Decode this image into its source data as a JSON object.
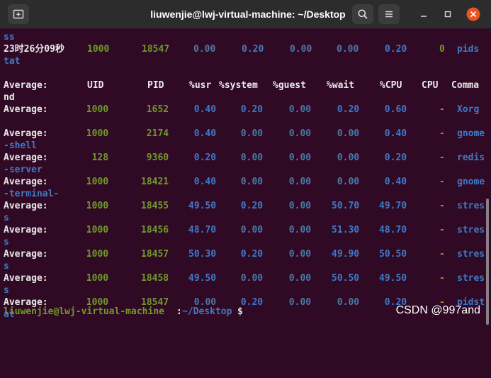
{
  "window": {
    "title": "liuwenjie@lwj-virtual-machine: ~/Desktop",
    "buttons": {
      "new_tab": "new-tab",
      "search": "search",
      "menu": "menu"
    }
  },
  "terminal": {
    "top_lines": [
      {
        "text": "ss"
      },
      {
        "time": "23时26分09秒",
        "uid": "1000",
        "pid": "18547",
        "usr": "0.00",
        "system": "0.20",
        "guest": "0.00",
        "wait": "0.00",
        "cpu": "0.20",
        "cpu_num": "0",
        "cmd": "pids"
      },
      {
        "text": "tat"
      }
    ],
    "header": {
      "label": "Average:",
      "uid": "UID",
      "pid": "PID",
      "usr": "%usr",
      "system": "%system",
      "guest": "%guest",
      "wait": "%wait",
      "cpupct": "%CPU",
      "cpu": "CPU",
      "cmd": "Comma",
      "cont": "nd"
    },
    "rows": [
      {
        "label": "Average:",
        "uid": "1000",
        "pid": "1652",
        "usr": "0.40",
        "system": "0.20",
        "guest": "0.00",
        "wait": "0.20",
        "cpupct": "0.60",
        "cpu": "-",
        "cmd": "Xorg",
        "cont": ""
      },
      {
        "label": "Average:",
        "uid": "1000",
        "pid": "2174",
        "usr": "0.40",
        "system": "0.00",
        "guest": "0.00",
        "wait": "0.00",
        "cpupct": "0.40",
        "cpu": "-",
        "cmd": "gnome",
        "cont": "-shell"
      },
      {
        "label": "Average:",
        "uid": "128",
        "pid": "9360",
        "usr": "0.20",
        "system": "0.00",
        "guest": "0.00",
        "wait": "0.00",
        "cpupct": "0.20",
        "cpu": "-",
        "cmd": "redis",
        "cont": "-server"
      },
      {
        "label": "Average:",
        "uid": "1000",
        "pid": "18421",
        "usr": "0.40",
        "system": "0.00",
        "guest": "0.00",
        "wait": "0.00",
        "cpupct": "0.40",
        "cpu": "-",
        "cmd": "gnome",
        "cont": "-terminal-"
      },
      {
        "label": "Average:",
        "uid": "1000",
        "pid": "18455",
        "usr": "49.50",
        "system": "0.20",
        "guest": "0.00",
        "wait": "50.70",
        "cpupct": "49.70",
        "cpu": "-",
        "cmd": "stres",
        "cont": "s"
      },
      {
        "label": "Average:",
        "uid": "1000",
        "pid": "18456",
        "usr": "48.70",
        "system": "0.00",
        "guest": "0.00",
        "wait": "51.30",
        "cpupct": "48.70",
        "cpu": "-",
        "cmd": "stres",
        "cont": "s"
      },
      {
        "label": "Average:",
        "uid": "1000",
        "pid": "18457",
        "usr": "50.30",
        "system": "0.20",
        "guest": "0.00",
        "wait": "49.90",
        "cpupct": "50.50",
        "cpu": "-",
        "cmd": "stres",
        "cont": "s"
      },
      {
        "label": "Average:",
        "uid": "1000",
        "pid": "18458",
        "usr": "49.50",
        "system": "0.00",
        "guest": "0.00",
        "wait": "50.50",
        "cpupct": "49.50",
        "cpu": "-",
        "cmd": "stres",
        "cont": "s"
      },
      {
        "label": "Average:",
        "uid": "1000",
        "pid": "18547",
        "usr": "0.00",
        "system": "0.20",
        "guest": "0.00",
        "wait": "0.00",
        "cpupct": "0.20",
        "cpu": "-",
        "cmd": "pidst",
        "cont": "at"
      }
    ],
    "prompt": {
      "user_host": "liuwenjie@lwj-virtual-machine",
      "sep": ":",
      "path": "~/Desktop",
      "symbol": "$"
    }
  },
  "watermark": "CSDN @997and",
  "colors": {
    "bg": "#300a24",
    "green": "#6f9a2a",
    "blue": "#3f79c8",
    "dim_blue": "#4b78a6"
  }
}
